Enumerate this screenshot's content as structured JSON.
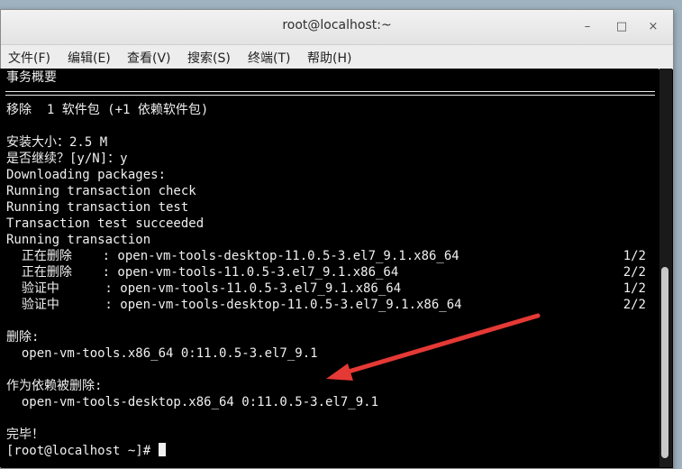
{
  "window": {
    "title": "root@localhost:~",
    "controls": {
      "minimize": "–",
      "maximize": "□",
      "close": "×"
    }
  },
  "menubar": {
    "items": [
      "文件(F)",
      "编辑(E)",
      "查看(V)",
      "搜索(S)",
      "终端(T)",
      "帮助(H)"
    ]
  },
  "terminal": {
    "lines": [
      "事务概要",
      "移除  1 软件包 (+1 依赖软件包)",
      "安装大小：2.5 M",
      "是否继续？[y/N]：y",
      "Downloading packages:",
      "Running transaction check",
      "Running transaction test",
      "Transaction test succeeded",
      "Running transaction",
      "  正在删除    : open-vm-tools-desktop-11.0.5-3.el7_9.1.x86_64",
      "  正在删除    : open-vm-tools-11.0.5-3.el7_9.1.x86_64",
      "  验证中      : open-vm-tools-11.0.5-3.el7_9.1.x86_64",
      "  验证中      : open-vm-tools-desktop-11.0.5-3.el7_9.1.x86_64",
      "删除:",
      "  open-vm-tools.x86_64 0:11.0.5-3.el7_9.1",
      "作为依赖被删除:",
      "  open-vm-tools-desktop.x86_64 0:11.0.5-3.el7_9.1",
      "完毕！",
      "[root@localhost ~]#"
    ],
    "progress": [
      "1/2",
      "2/2",
      "1/2",
      "2/2"
    ]
  },
  "annotation": {
    "color": "#e53935",
    "shape": "arrow"
  }
}
